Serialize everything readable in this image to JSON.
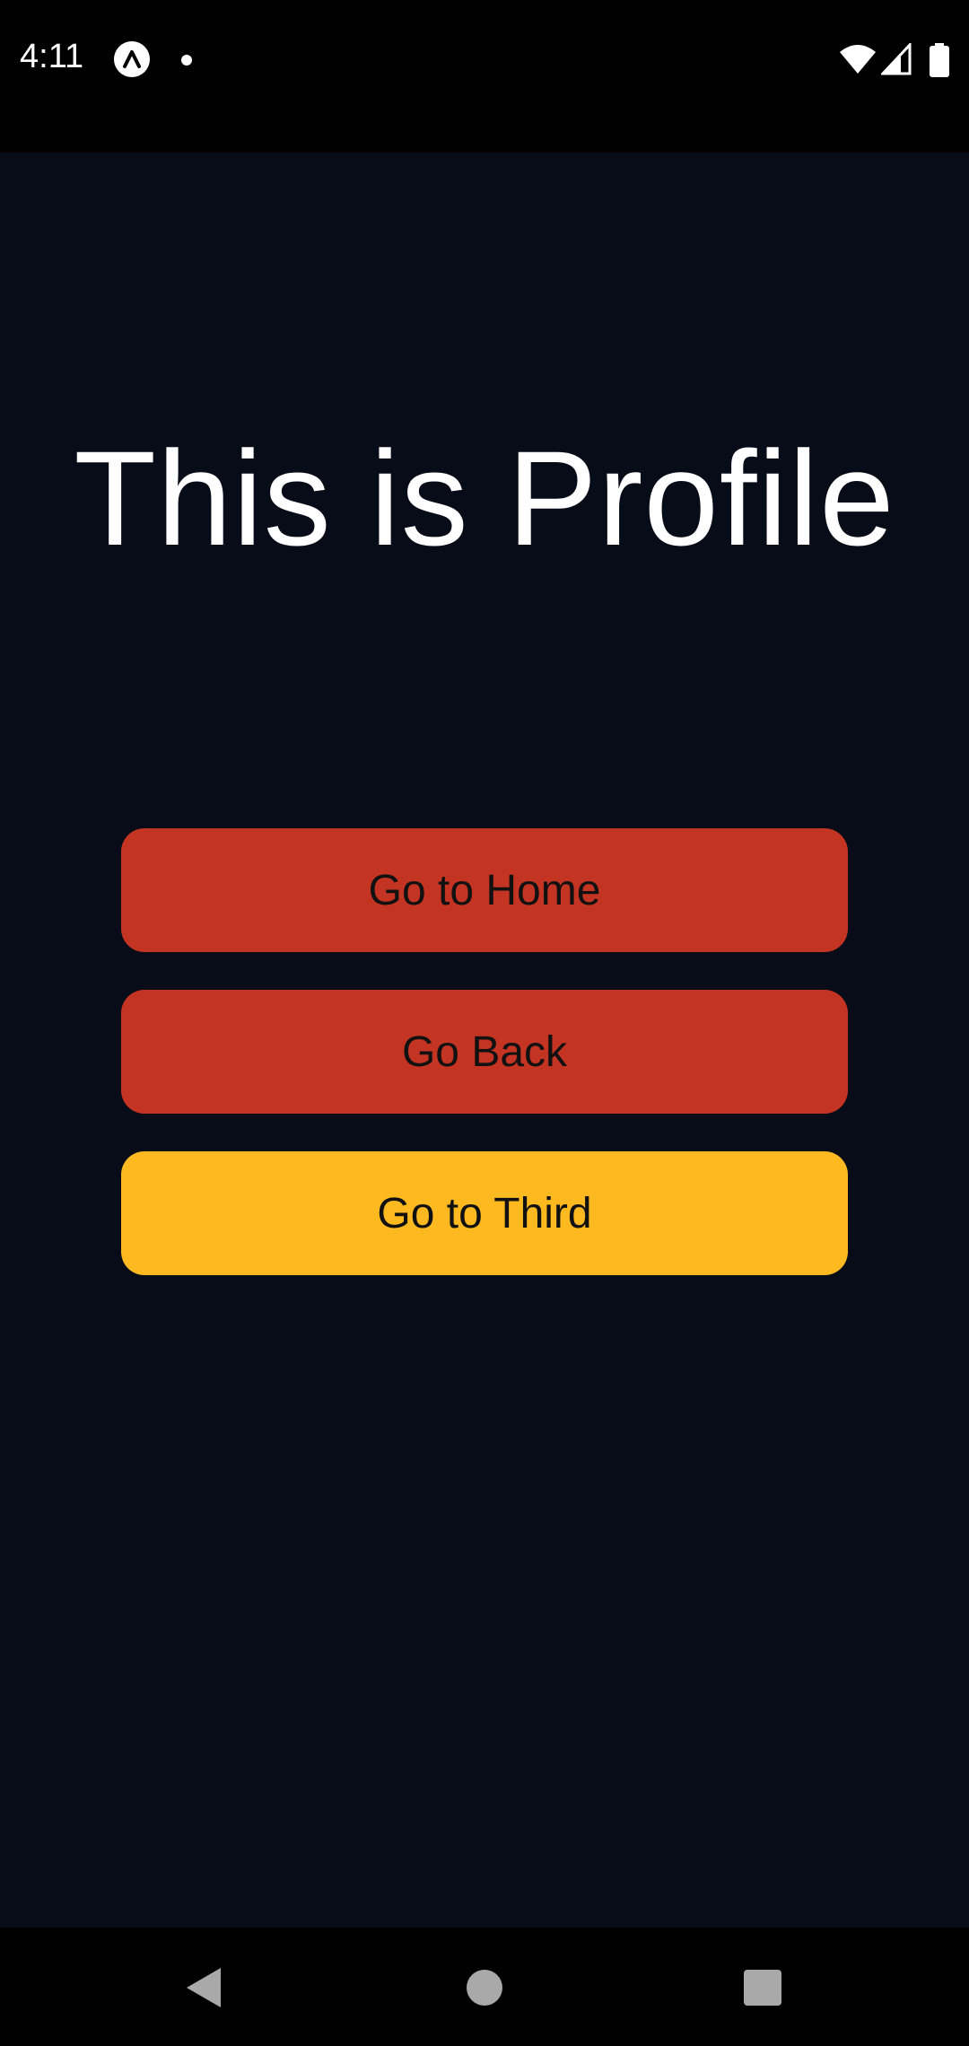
{
  "status_bar": {
    "time": "4:11"
  },
  "title": "This is Profile",
  "buttons": {
    "home": "Go to Home",
    "back": "Go Back",
    "third": "Go to Third"
  },
  "colors": {
    "background": "#080c18",
    "button_red": "#c43422",
    "button_yellow": "#fdb91f"
  },
  "icons": {
    "status": [
      "expo-icon",
      "notification-dot-icon",
      "wifi-icon",
      "signal-icon",
      "battery-icon"
    ],
    "navigation": [
      "nav-back-icon",
      "nav-home-icon",
      "nav-recents-icon"
    ]
  }
}
